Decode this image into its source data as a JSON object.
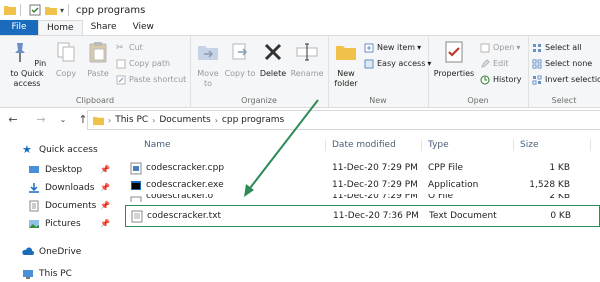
{
  "window": {
    "title": "cpp programs"
  },
  "tabs": [
    {
      "label": "File"
    },
    {
      "label": "Home"
    },
    {
      "label": "Share"
    },
    {
      "label": "View"
    }
  ],
  "ribbon": {
    "clipboard": {
      "group_label": "Clipboard",
      "pin_label": "Pin to Quick access",
      "copy_label": "Copy",
      "paste_label": "Paste",
      "cut_label": "Cut",
      "copy_path_label": "Copy path",
      "paste_shortcut_label": "Paste shortcut"
    },
    "organize": {
      "group_label": "Organize",
      "move_to_label": "Move to",
      "copy_to_label": "Copy to",
      "delete_label": "Delete",
      "rename_label": "Rename"
    },
    "new": {
      "group_label": "New",
      "new_folder_label": "New folder",
      "new_item_label": "New item",
      "easy_access_label": "Easy access"
    },
    "open": {
      "group_label": "Open",
      "properties_label": "Properties",
      "open_label": "Open",
      "edit_label": "Edit",
      "history_label": "History"
    },
    "select": {
      "group_label": "Select",
      "select_all_label": "Select all",
      "select_none_label": "Select none",
      "invert_selection_label": "Invert selection"
    }
  },
  "address": {
    "crumbs": [
      "This PC",
      "Documents",
      "cpp programs"
    ]
  },
  "nav": {
    "quick_access": "Quick access",
    "items": [
      {
        "label": "Desktop"
      },
      {
        "label": "Downloads"
      },
      {
        "label": "Documents"
      },
      {
        "label": "Pictures"
      }
    ],
    "onedrive": "OneDrive",
    "this_pc": "This PC"
  },
  "columns": {
    "name": "Name",
    "date": "Date modified",
    "type": "Type",
    "size": "Size"
  },
  "files": [
    {
      "name": "codescracker.cpp",
      "date": "11-Dec-20 7:29 PM",
      "type": "CPP File",
      "size": "1 KB"
    },
    {
      "name": "codescracker.exe",
      "date": "11-Dec-20 7:29 PM",
      "type": "Application",
      "size": "1,528 KB"
    },
    {
      "name": "codescracker.o",
      "date": "11-Dec-20 7:29 PM",
      "type": "O File",
      "size": "2 KB"
    },
    {
      "name": "codescracker.txt",
      "date": "11-Dec-20 7:36 PM",
      "type": "Text Document",
      "size": "0 KB"
    }
  ],
  "colors": {
    "file_tab": "#1a6bbc",
    "annotation": "#2e8b57",
    "folder": "#f0c24b"
  }
}
